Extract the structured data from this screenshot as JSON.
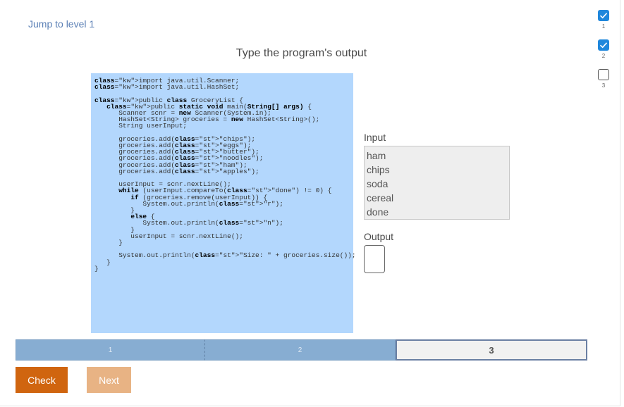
{
  "jump_link": "Jump to level 1",
  "title": "Type the program's output",
  "code_lines": [
    "import java.util.Scanner;",
    "import java.util.HashSet;",
    "",
    "public class GroceryList {",
    "   public static void main(String[] args) {",
    "      Scanner scnr = new Scanner(System.in);",
    "      HashSet<String> groceries = new HashSet<String>();",
    "      String userInput;",
    "",
    "      groceries.add(\"chips\");",
    "      groceries.add(\"eggs\");",
    "      groceries.add(\"butter\");",
    "      groceries.add(\"noodles\");",
    "      groceries.add(\"ham\");",
    "      groceries.add(\"apples\");",
    "",
    "      userInput = scnr.nextLine();",
    "      while (userInput.compareTo(\"done\") != 0) {",
    "         if (groceries.remove(userInput)) {",
    "            System.out.println(\"r\");",
    "         }",
    "         else {",
    "            System.out.println(\"n\");",
    "         }",
    "         userInput = scnr.nextLine();",
    "      }",
    "",
    "      System.out.println(\"Size: \" + groceries.size());",
    "   }",
    "}"
  ],
  "input_label": "Input",
  "input_lines": [
    "ham",
    "chips",
    "soda",
    "cereal",
    "done"
  ],
  "output_label": "Output",
  "output_value": "",
  "progress": [
    {
      "label": "1",
      "state": "complete"
    },
    {
      "label": "2",
      "state": "complete"
    },
    {
      "label": "3",
      "state": "current"
    }
  ],
  "buttons": {
    "check": "Check",
    "next": "Next"
  },
  "levels": [
    {
      "label": "1",
      "state": "done"
    },
    {
      "label": "2",
      "state": "done"
    },
    {
      "label": "3",
      "state": "todo"
    }
  ],
  "colors": {
    "accent": "#1f87dc",
    "check": "#d0650f",
    "next": "#e8b384",
    "code_bg": "#b3d7fd"
  }
}
